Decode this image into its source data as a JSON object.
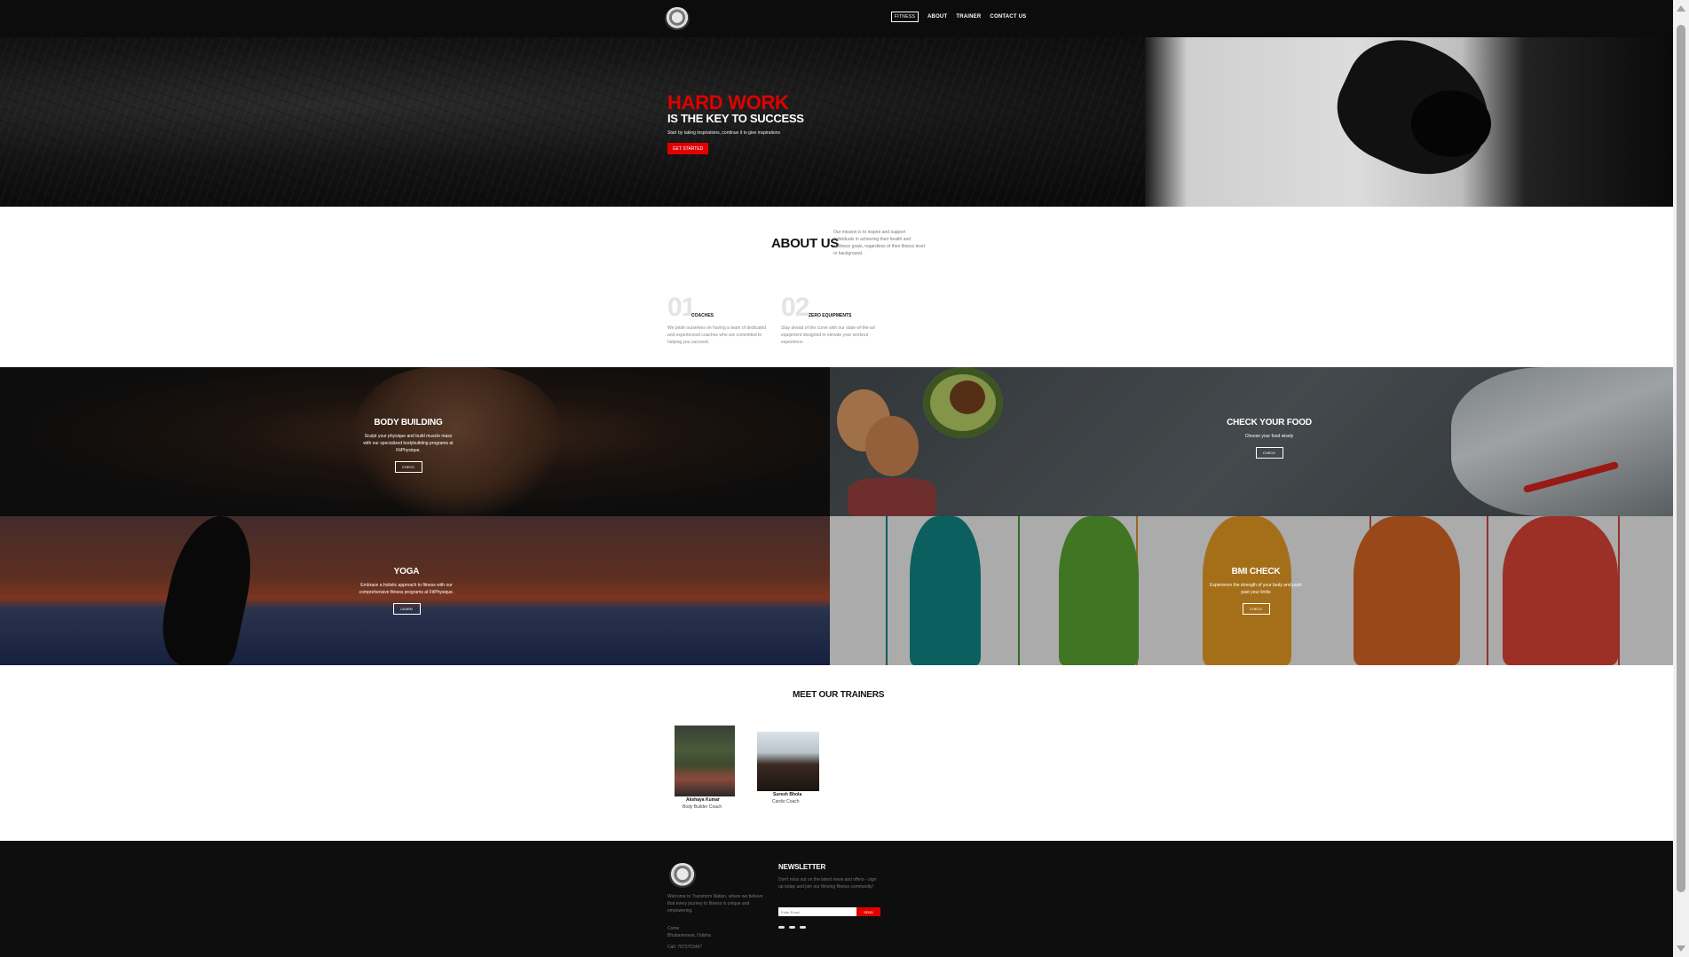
{
  "header": {
    "nav_button": "FITNESS",
    "nav_links": [
      "ABOUT",
      "TRAINER",
      "CONTACT US"
    ]
  },
  "hero": {
    "title": "HARD WORK",
    "subtitle": "IS THE KEY TO SUCCESS",
    "description": "Start by taking inspirations, continue it to give inspirations",
    "button": "GET STARTED"
  },
  "about": {
    "title": "ABOUT US",
    "text": "Our mission is to inspire and support individuals in achieving their health and wellness goals, regardless of their fitness level or background.",
    "features": [
      {
        "num": "01",
        "name": "COACHES",
        "desc": "We pride ourselves on having a team of dedicated and experienced coaches who are committed to helping you succeed."
      },
      {
        "num": "02",
        "name": "ZERO EQUIPMENTS",
        "desc": "Stay ahead of the curve with our state-of-the-art equipment designed to elevate your workout experience."
      }
    ]
  },
  "tiles": {
    "body_building": {
      "title": "BODY BUILDING",
      "desc": "Sculpt your physique and build muscle mass with our specialized bodybuilding programs at FitPhysique.",
      "button": "CHECK"
    },
    "food": {
      "title": "CHECK YOUR FOOD",
      "desc": "Choose your food wisely",
      "button": "CHECK"
    },
    "yoga": {
      "title": "YOGA",
      "desc": "Embrace a holistic approach to fitness with our comprehensive fitness programs at FitPhysique.",
      "button": "LEARN"
    },
    "bmi": {
      "title": "BMI CHECK",
      "desc": "Experience the strength of your body and push past your limits",
      "button": "CHECK"
    }
  },
  "trainers": {
    "title": "MEET OUR TRAINERS",
    "items": [
      {
        "name": "Akshaya Kumar",
        "role": "Body Builder Coach"
      },
      {
        "name": "Suresh Bhola",
        "role": "Cardio Coach"
      }
    ]
  },
  "footer": {
    "about": "Welcome to Transform Nation, where we believe that every journey to fitness is unique and empowering.",
    "location_label": "Come",
    "location": "Bhubaneswar, Odisha",
    "call": "Call: 7873753467",
    "newsletter_title": "NEWSLETTER",
    "newsletter_text": "Don't miss out on the latest news and offers - sign up today and join our thriving fitness community!",
    "input_placeholder": "Enter Email",
    "send_button": "SEND",
    "social_icons": [
      "facebook-icon",
      "instagram-icon",
      "twitter-icon"
    ]
  },
  "colors": {
    "accent": "#e00000",
    "dark": "#0c0c0c"
  }
}
